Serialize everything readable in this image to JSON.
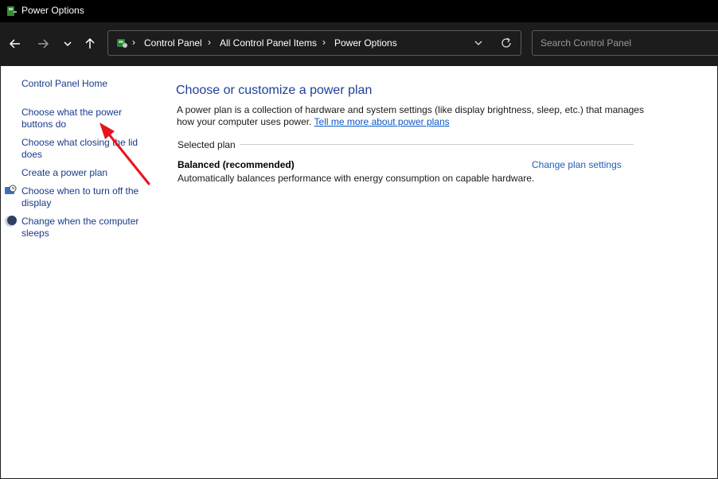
{
  "window": {
    "title": "Power Options"
  },
  "nav": {
    "breadcrumbs": [
      "Control Panel",
      "All Control Panel Items",
      "Power Options"
    ],
    "search_placeholder": "Search Control Panel"
  },
  "sidebar": {
    "home": "Control Panel Home",
    "items": [
      {
        "label": "Choose what the power buttons do",
        "icon": ""
      },
      {
        "label": "Choose what closing the lid does",
        "icon": ""
      },
      {
        "label": "Create a power plan",
        "icon": ""
      },
      {
        "label": "Choose when to turn off the display",
        "icon": "monitor-clock-icon"
      },
      {
        "label": "Change when the computer sleeps",
        "icon": "moon-icon"
      }
    ]
  },
  "main": {
    "title": "Choose or customize a power plan",
    "description": "A power plan is a collection of hardware and system settings (like display brightness, sleep, etc.) that manages how your computer uses power.",
    "learn_more": "Tell me more about power plans",
    "selected_label": "Selected plan",
    "plan": {
      "name": "Balanced (recommended)",
      "change_label": "Change plan settings",
      "description": "Automatically balances performance with energy consumption on capable hardware."
    }
  },
  "annotation": {
    "color": "#e8141c"
  }
}
